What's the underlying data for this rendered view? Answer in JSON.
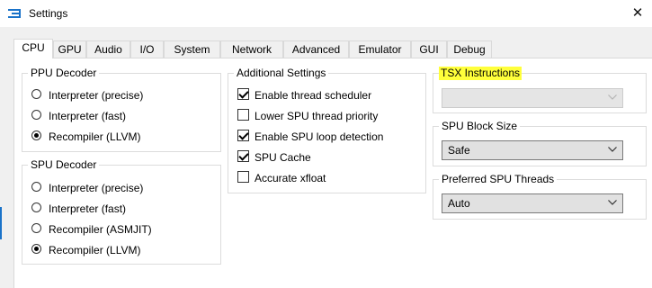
{
  "window": {
    "title": "Settings",
    "close_glyph": "✕",
    "icon": "rpcs3-logo-icon",
    "accent_color": "#1a73c9"
  },
  "tabs": [
    "CPU",
    "GPU",
    "Audio",
    "I/O",
    "System",
    "Network",
    "Advanced",
    "Emulator",
    "GUI",
    "Debug"
  ],
  "active_tab": "CPU",
  "ppu_decoder": {
    "title": "PPU Decoder",
    "options": [
      {
        "label": "Interpreter (precise)",
        "selected": false
      },
      {
        "label": "Interpreter (fast)",
        "selected": false
      },
      {
        "label": "Recompiler (LLVM)",
        "selected": true
      }
    ]
  },
  "spu_decoder": {
    "title": "SPU Decoder",
    "options": [
      {
        "label": "Interpreter (precise)",
        "selected": false
      },
      {
        "label": "Interpreter (fast)",
        "selected": false
      },
      {
        "label": "Recompiler (ASMJIT)",
        "selected": false
      },
      {
        "label": "Recompiler (LLVM)",
        "selected": true
      }
    ]
  },
  "additional_settings": {
    "title": "Additional Settings",
    "items": [
      {
        "label": "Enable thread scheduler",
        "checked": true
      },
      {
        "label": "Lower SPU thread priority",
        "checked": false
      },
      {
        "label": "Enable SPU loop detection",
        "checked": true
      },
      {
        "label": "SPU Cache",
        "checked": true
      },
      {
        "label": "Accurate xfloat",
        "checked": false
      }
    ]
  },
  "tsx_instructions": {
    "title": "TSX Instructions",
    "value": "",
    "disabled": true,
    "highlight_color": "#ffff3b"
  },
  "spu_block_size": {
    "title": "SPU Block Size",
    "value": "Safe"
  },
  "preferred_spu_threads": {
    "title": "Preferred SPU Threads",
    "value": "Auto"
  }
}
